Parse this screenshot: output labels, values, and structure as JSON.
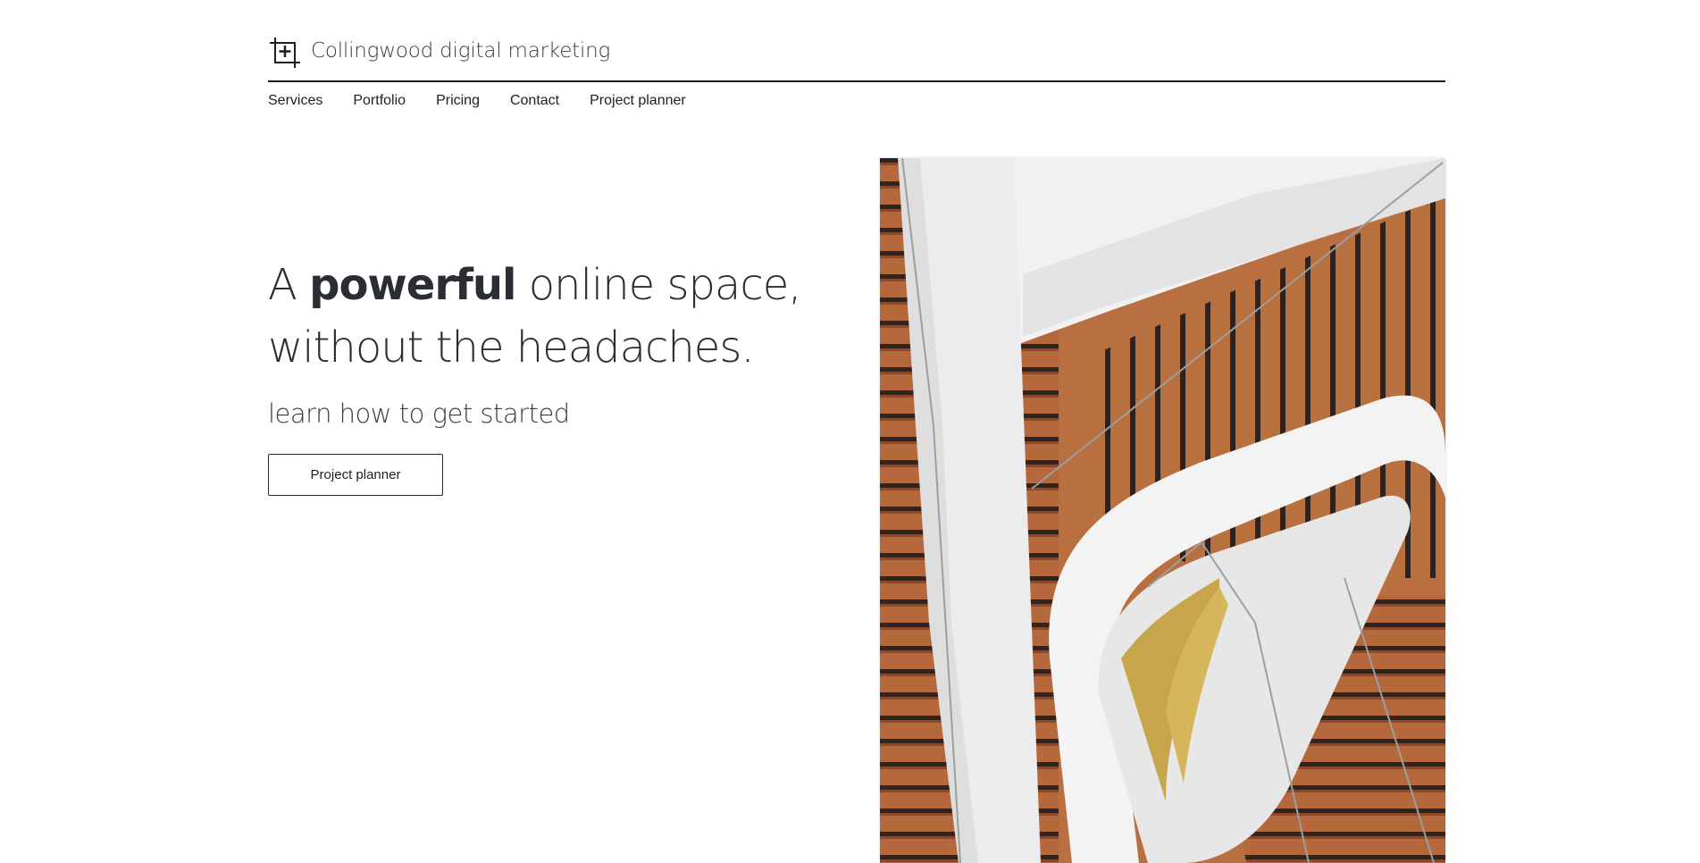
{
  "header": {
    "brand": "Collingwood digital marketing",
    "logo_icon": "crop-add-icon"
  },
  "nav": {
    "items": [
      {
        "label": "Services"
      },
      {
        "label": "Portfolio"
      },
      {
        "label": "Pricing"
      },
      {
        "label": "Contact"
      },
      {
        "label": "Project planner"
      }
    ]
  },
  "hero": {
    "headline_start": "A ",
    "headline_bold": "powerful",
    "headline_end": " online space, without the headaches.",
    "subheading": "learn how to get started",
    "cta_label": "Project planner"
  },
  "image": {
    "subject": "staircase-photo"
  },
  "colors": {
    "text": "#2a2d33",
    "rule": "#1e1e1e",
    "wood": "#b5683b"
  }
}
